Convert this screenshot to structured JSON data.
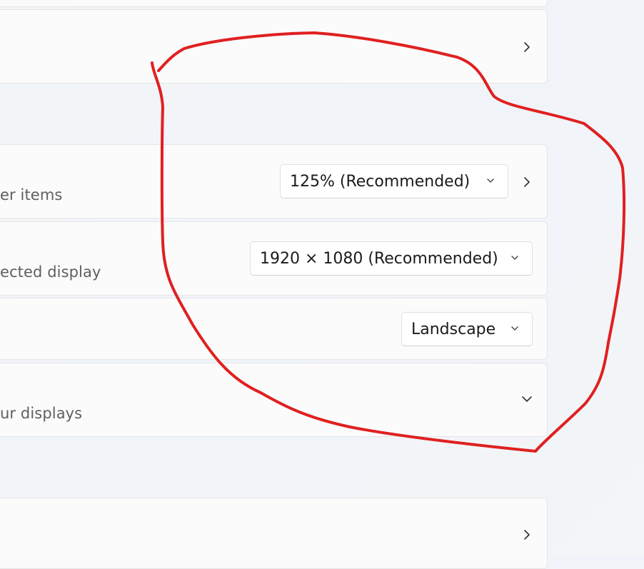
{
  "scale": {
    "subtitle": "er items",
    "dropdown_value": "125% (Recommended)"
  },
  "resolution": {
    "subtitle": "ected display",
    "dropdown_value": "1920 × 1080 (Recommended)"
  },
  "orientation": {
    "dropdown_value": "Landscape"
  },
  "multiple_displays": {
    "subtitle": "ur displays"
  },
  "icons": {
    "nav": "chevron-right-icon",
    "expand": "chevron-down-icon",
    "dropdown": "chevron-down-icon"
  },
  "colors": {
    "annotation": "#e02020",
    "card": "#fbfbfc",
    "background": "#f3f5f8"
  }
}
